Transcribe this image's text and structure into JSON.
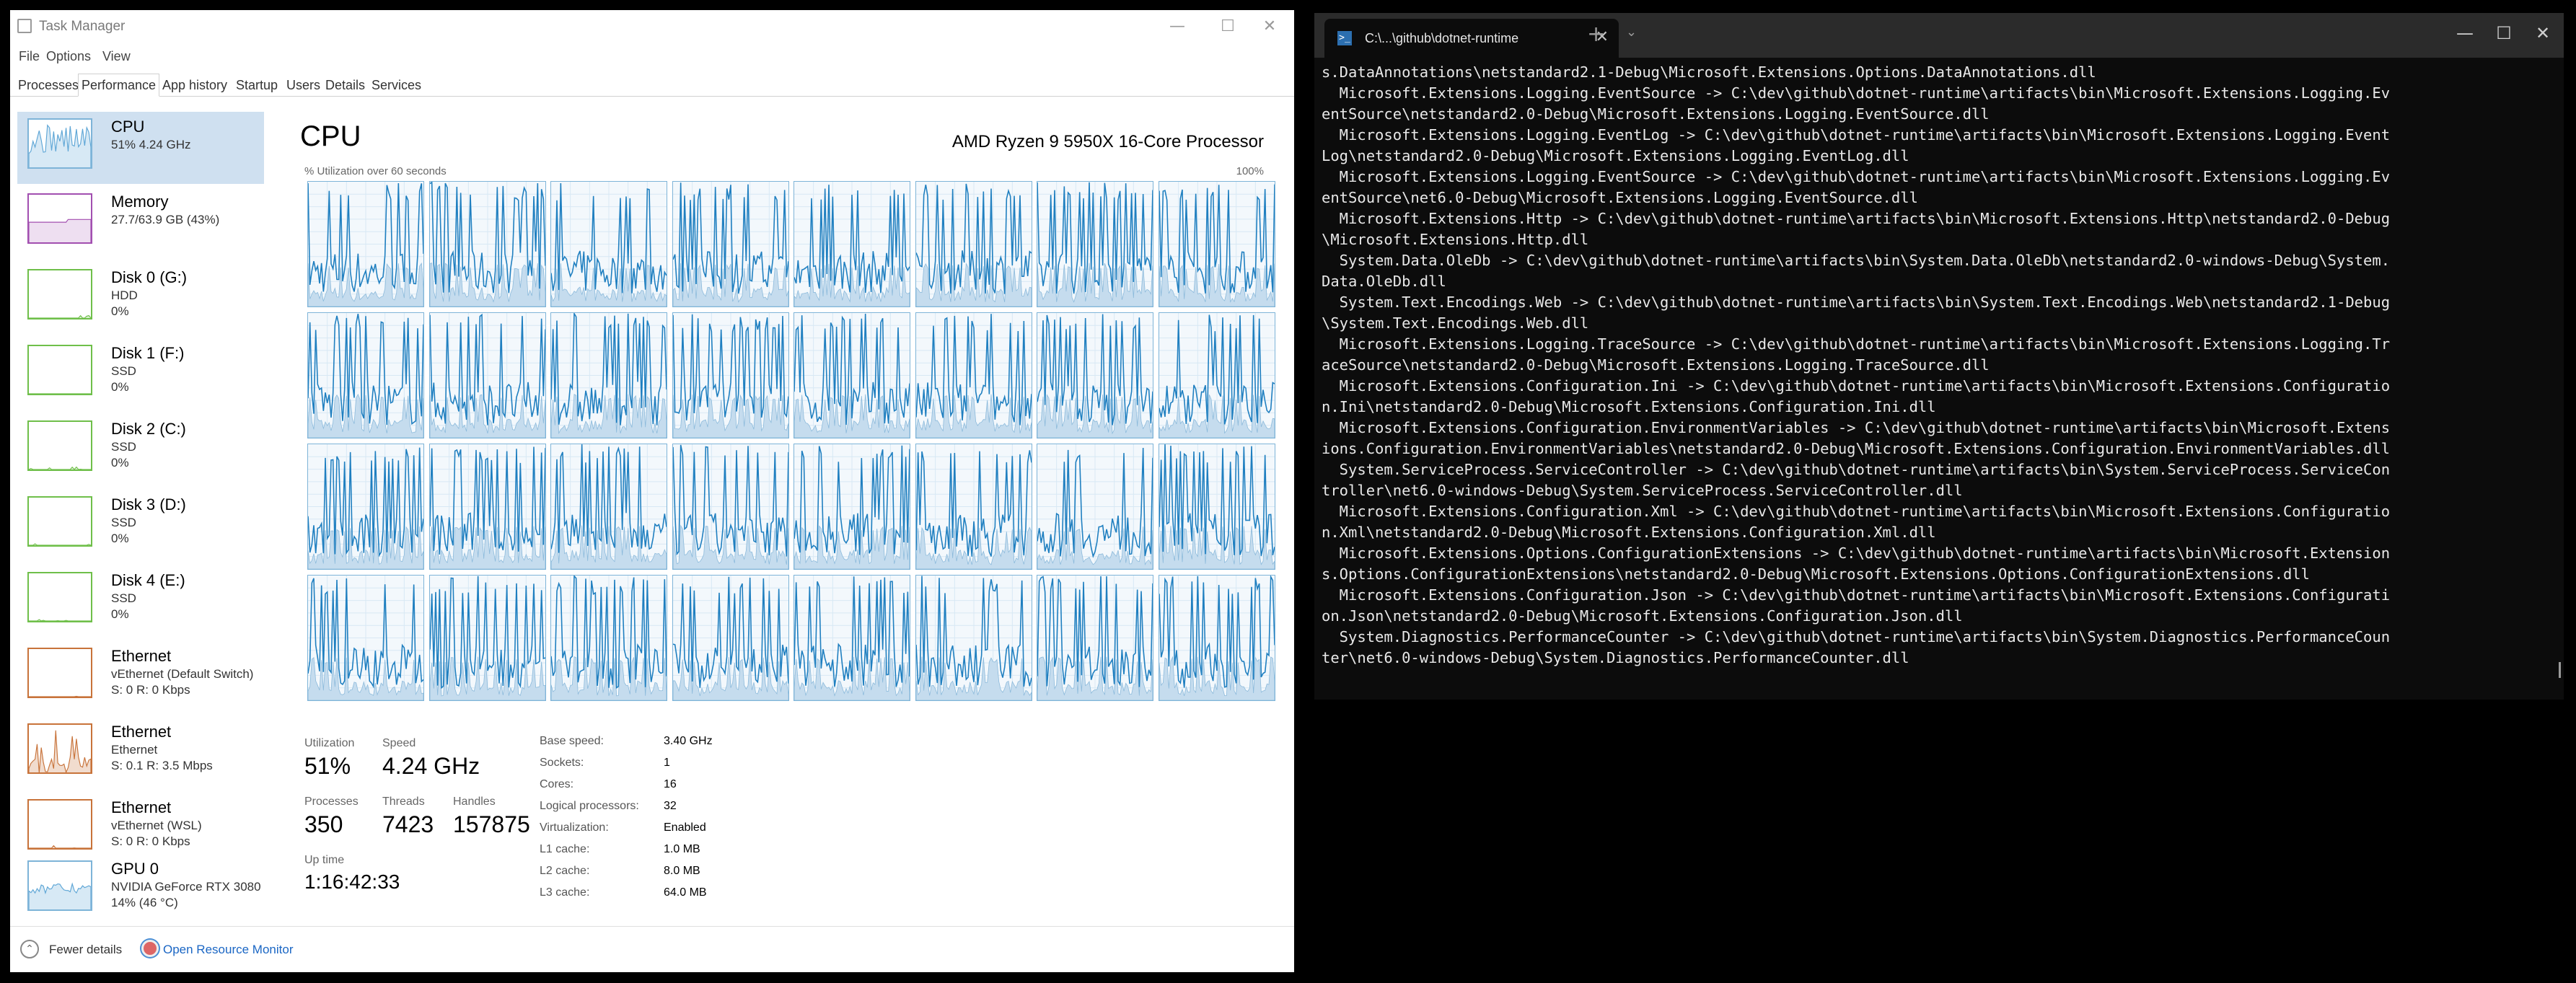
{
  "task_manager": {
    "title": "Task Manager",
    "window_controls": {
      "minimize": "—",
      "maximize": "☐",
      "close": "✕"
    },
    "menu": [
      "File",
      "Options",
      "View"
    ],
    "tabs": [
      "Processes",
      "Performance",
      "App history",
      "Startup",
      "Users",
      "Details",
      "Services"
    ],
    "active_tab": "Performance",
    "sidebar": [
      {
        "name": "CPU",
        "sub1": "51%  4.24 GHz",
        "sub2": "",
        "thumb_color": "#5ea6d6"
      },
      {
        "name": "Memory",
        "sub1": "27.7/63.9 GB (43%)",
        "sub2": "",
        "thumb_color": "#a24fb0"
      },
      {
        "name": "Disk 0 (G:)",
        "sub1": "HDD",
        "sub2": "0%",
        "thumb_color": "#6fbf4a"
      },
      {
        "name": "Disk 1 (F:)",
        "sub1": "SSD",
        "sub2": "0%",
        "thumb_color": "#6fbf4a"
      },
      {
        "name": "Disk 2 (C:)",
        "sub1": "SSD",
        "sub2": "0%",
        "thumb_color": "#6fbf4a"
      },
      {
        "name": "Disk 3 (D:)",
        "sub1": "SSD",
        "sub2": "0%",
        "thumb_color": "#6fbf4a"
      },
      {
        "name": "Disk 4 (E:)",
        "sub1": "SSD",
        "sub2": "0%",
        "thumb_color": "#6fbf4a"
      },
      {
        "name": "Ethernet",
        "sub1": "vEthernet (Default Switch)",
        "sub2": "S: 0  R: 0 Kbps",
        "thumb_color": "#c8733a"
      },
      {
        "name": "Ethernet",
        "sub1": "Ethernet",
        "sub2": "S: 0.1  R: 3.5 Mbps",
        "thumb_color": "#c8733a"
      },
      {
        "name": "Ethernet",
        "sub1": "vEthernet (WSL)",
        "sub2": "S: 0  R: 0 Kbps",
        "thumb_color": "#c8733a"
      },
      {
        "name": "GPU 0",
        "sub1": "NVIDIA GeForce RTX 3080",
        "sub2": "14%  (46 °C)",
        "thumb_color": "#5ea6d6"
      }
    ],
    "cpu": {
      "title": "CPU",
      "model": "AMD Ryzen 9 5950X 16-Core Processor",
      "util_caption": "% Utilization over 60 seconds",
      "util_max": "100%",
      "logical_processor_graphs": 32,
      "stats": {
        "utilization_label": "Utilization",
        "utilization": "51%",
        "speed_label": "Speed",
        "speed": "4.24 GHz",
        "processes_label": "Processes",
        "processes": "350",
        "threads_label": "Threads",
        "threads": "7423",
        "handles_label": "Handles",
        "handles": "157875",
        "uptime_label": "Up time",
        "uptime": "1:16:42:33"
      },
      "details": [
        {
          "label": "Base speed:",
          "value": "3.40 GHz"
        },
        {
          "label": "Sockets:",
          "value": "1"
        },
        {
          "label": "Cores:",
          "value": "16"
        },
        {
          "label": "Logical processors:",
          "value": "32"
        },
        {
          "label": "Virtualization:",
          "value": "Enabled"
        },
        {
          "label": "L1 cache:",
          "value": "1.0 MB"
        },
        {
          "label": "L2 cache:",
          "value": "8.0 MB"
        },
        {
          "label": "L3 cache:",
          "value": "64.0 MB"
        }
      ]
    },
    "footer": {
      "fewer_details": "Fewer details",
      "open_resource_monitor": "Open Resource Monitor"
    }
  },
  "terminal": {
    "tab_title": "C:\\...\\github\\dotnet-runtime",
    "tab_icon": ">_",
    "new_tab": "+",
    "dropdown": "⌄",
    "window_controls": {
      "minimize": "—",
      "maximize": "☐",
      "close": "✕"
    },
    "lines": [
      "s.DataAnnotations\\netstandard2.1-Debug\\Microsoft.Extensions.Options.DataAnnotations.dll",
      "  Microsoft.Extensions.Logging.EventSource -> C:\\dev\\github\\dotnet-runtime\\artifacts\\bin\\Microsoft.Extensions.Logging.Ev",
      "entSource\\netstandard2.0-Debug\\Microsoft.Extensions.Logging.EventSource.dll",
      "  Microsoft.Extensions.Logging.EventLog -> C:\\dev\\github\\dotnet-runtime\\artifacts\\bin\\Microsoft.Extensions.Logging.Event",
      "Log\\netstandard2.0-Debug\\Microsoft.Extensions.Logging.EventLog.dll",
      "  Microsoft.Extensions.Logging.EventSource -> C:\\dev\\github\\dotnet-runtime\\artifacts\\bin\\Microsoft.Extensions.Logging.Ev",
      "entSource\\net6.0-Debug\\Microsoft.Extensions.Logging.EventSource.dll",
      "  Microsoft.Extensions.Http -> C:\\dev\\github\\dotnet-runtime\\artifacts\\bin\\Microsoft.Extensions.Http\\netstandard2.0-Debug",
      "\\Microsoft.Extensions.Http.dll",
      "  System.Data.OleDb -> C:\\dev\\github\\dotnet-runtime\\artifacts\\bin\\System.Data.OleDb\\netstandard2.0-windows-Debug\\System.",
      "Data.OleDb.dll",
      "  System.Text.Encodings.Web -> C:\\dev\\github\\dotnet-runtime\\artifacts\\bin\\System.Text.Encodings.Web\\netstandard2.1-Debug",
      "\\System.Text.Encodings.Web.dll",
      "  Microsoft.Extensions.Logging.TraceSource -> C:\\dev\\github\\dotnet-runtime\\artifacts\\bin\\Microsoft.Extensions.Logging.Tr",
      "aceSource\\netstandard2.0-Debug\\Microsoft.Extensions.Logging.TraceSource.dll",
      "  Microsoft.Extensions.Configuration.Ini -> C:\\dev\\github\\dotnet-runtime\\artifacts\\bin\\Microsoft.Extensions.Configuratio",
      "n.Ini\\netstandard2.0-Debug\\Microsoft.Extensions.Configuration.Ini.dll",
      "  Microsoft.Extensions.Configuration.EnvironmentVariables -> C:\\dev\\github\\dotnet-runtime\\artifacts\\bin\\Microsoft.Extens",
      "ions.Configuration.EnvironmentVariables\\netstandard2.0-Debug\\Microsoft.Extensions.Configuration.EnvironmentVariables.dll",
      "  System.ServiceProcess.ServiceController -> C:\\dev\\github\\dotnet-runtime\\artifacts\\bin\\System.ServiceProcess.ServiceCon",
      "troller\\net6.0-windows-Debug\\System.ServiceProcess.ServiceController.dll",
      "  Microsoft.Extensions.Configuration.Xml -> C:\\dev\\github\\dotnet-runtime\\artifacts\\bin\\Microsoft.Extensions.Configuratio",
      "n.Xml\\netstandard2.0-Debug\\Microsoft.Extensions.Configuration.Xml.dll",
      "  Microsoft.Extensions.Options.ConfigurationExtensions -> C:\\dev\\github\\dotnet-runtime\\artifacts\\bin\\Microsoft.Extension",
      "s.Options.ConfigurationExtensions\\netstandard2.0-Debug\\Microsoft.Extensions.Options.ConfigurationExtensions.dll",
      "  Microsoft.Extensions.Configuration.Json -> C:\\dev\\github\\dotnet-runtime\\artifacts\\bin\\Microsoft.Extensions.Configurati",
      "on.Json\\netstandard2.0-Debug\\Microsoft.Extensions.Configuration.Json.dll",
      "  System.Diagnostics.PerformanceCounter -> C:\\dev\\github\\dotnet-runtime\\artifacts\\bin\\System.Diagnostics.PerformanceCoun",
      "ter\\net6.0-windows-Debug\\System.Diagnostics.PerformanceCounter.dll"
    ]
  }
}
